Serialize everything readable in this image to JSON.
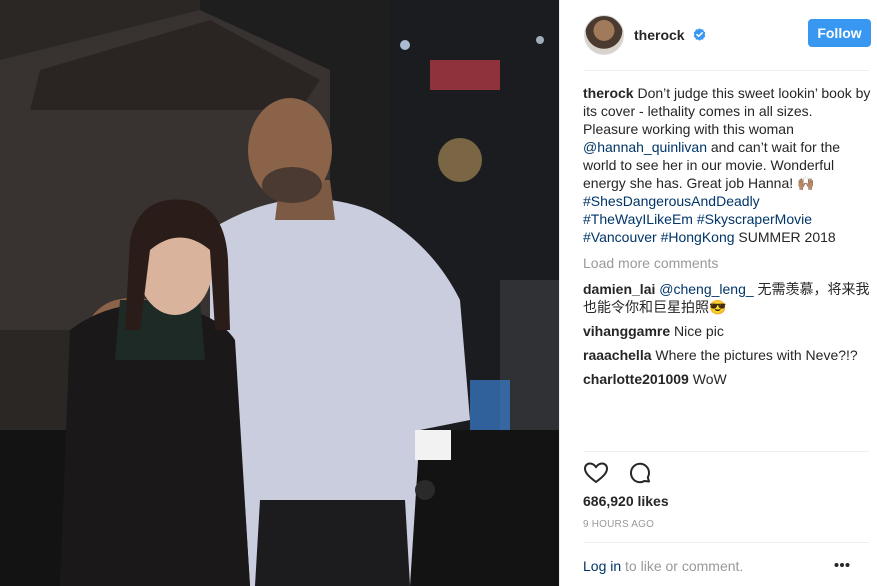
{
  "post": {
    "author": {
      "username": "therock",
      "verified": true,
      "avatar": "avatar-photo"
    },
    "follow_label": "Follow",
    "caption": {
      "username": "therock",
      "line1": " Don’t judge this sweet lookin’ book by its cover - lethality comes in all sizes.",
      "line2_prefix": "Pleasure working with this woman ",
      "mention": "@hannah_quinlivan",
      "line2_suffix": " and can’t wait for the world to see her in our movie. Wonderful energy she has. Great job Hanna! 🙌🏽",
      "hashtag1": "#ShesDangerousAndDeadly",
      "hashtag2": "#TheWayILikeEm",
      "hashtag3": "#SkyscraperMovie",
      "hashtag4": "#Vancouver",
      "hashtag5": "#HongKong",
      "tail": " SUMMER 2018"
    },
    "load_more_label": "Load more comments",
    "comments": [
      {
        "username": "damien_lai",
        "mention": "@cheng_leng_",
        "text": " 无需羡慕，将来我也能令你和巨星拍照😎"
      },
      {
        "username": "vihanggamre",
        "text": " Nice pic"
      },
      {
        "username": "raaachella",
        "text": " Where the pictures with Neve?!?"
      },
      {
        "username": "charlotte201009",
        "text": " WoW"
      }
    ],
    "likes": "686,920 likes",
    "timestamp": "9 HOURS AGO",
    "footer": {
      "login_label": "Log in",
      "suffix": " to like or comment."
    },
    "icons": {
      "like": "heart-outline-icon",
      "comment": "comment-bubble-icon",
      "more": "more-options-icon",
      "verified": "verified-badge-icon"
    },
    "colors": {
      "follow_button": "#3897f0",
      "link": "#003569",
      "muted": "#999999",
      "verified": "#3897f0"
    }
  }
}
